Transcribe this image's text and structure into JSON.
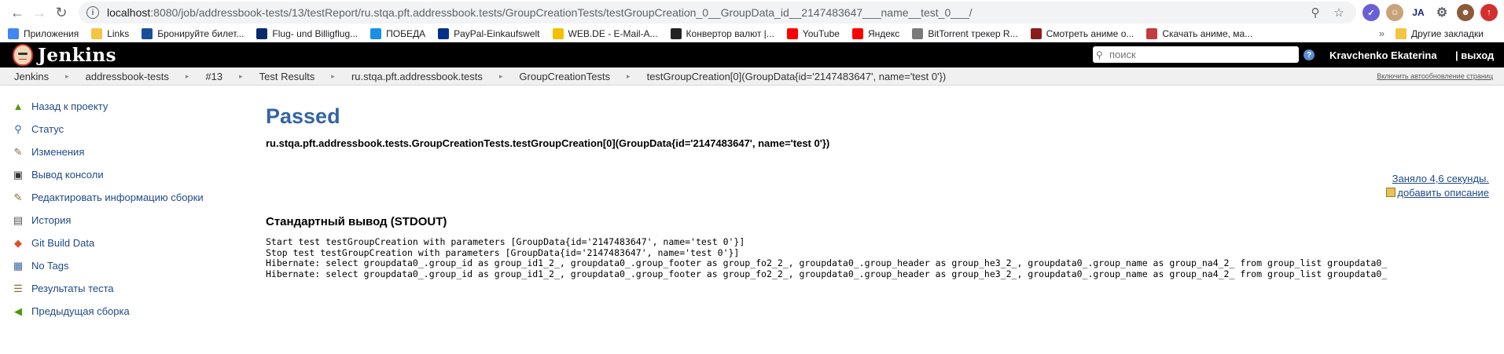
{
  "browser": {
    "url_host": "localhost",
    "url_path": ":8080/job/addressbook-tests/13/testReport/ru.stqa.pft.addressbook.tests/GroupCreationTests/testGroupCreation_0__GroupData_id__2147483647___name__test_0___/"
  },
  "bookmarks": [
    {
      "label": "Приложения",
      "icon": "apps-icon",
      "color": "#4285f4"
    },
    {
      "label": "Links",
      "icon": "folder-icon",
      "color": "#f4c542"
    },
    {
      "label": "Бронируйте билет...",
      "icon": "airline-icon",
      "color": "#1a4e9a"
    },
    {
      "label": "Flug- und Billigflug...",
      "icon": "info-icon",
      "color": "#0b2a6b"
    },
    {
      "label": "ПОБЕДА",
      "icon": "pobeda-icon",
      "color": "#1a8fe3"
    },
    {
      "label": "PayPal-Einkaufswelt",
      "icon": "paypal-icon",
      "color": "#003087"
    },
    {
      "label": "WEB.DE - E-Mail-A...",
      "icon": "webde-icon",
      "color": "#f3c100"
    },
    {
      "label": "Конвертор валют |...",
      "icon": "converter-icon",
      "color": "#222"
    },
    {
      "label": "YouTube",
      "icon": "youtube-icon",
      "color": "#ff0000"
    },
    {
      "label": "Яндекс",
      "icon": "yandex-icon",
      "color": "#ff0000"
    },
    {
      "label": "BitTorrent трекер R...",
      "icon": "torrent-icon",
      "color": "#7a7a7a"
    },
    {
      "label": "Смотреть аниме о...",
      "icon": "anime-icon",
      "color": "#8b1c1c"
    },
    {
      "label": "Скачать аниме, ма...",
      "icon": "anime2-icon",
      "color": "#c43c3c"
    }
  ],
  "bookmarks_other": "Другие закладки",
  "jenkins": {
    "title": "Jenkins",
    "search_placeholder": "поиск",
    "user": "Kravchenko Ekaterina",
    "logout": "| выход"
  },
  "breadcrumbs": [
    "Jenkins",
    "addressbook-tests",
    "#13",
    "Test Results",
    "ru.stqa.pft.addressbook.tests",
    "GroupCreationTests",
    "testGroupCreation[0](GroupData{id='2147483647', name='test 0'})"
  ],
  "auto_refresh": "Включить автообновление страниц",
  "sidebar": [
    {
      "label": "Назад к проекту",
      "icon": "up-arrow-icon"
    },
    {
      "label": "Статус",
      "icon": "search-icon"
    },
    {
      "label": "Изменения",
      "icon": "notepad-icon"
    },
    {
      "label": "Вывод консоли",
      "icon": "terminal-icon"
    },
    {
      "label": "Редактировать информацию сборки",
      "icon": "notepad-icon"
    },
    {
      "label": "История",
      "icon": "history-icon"
    },
    {
      "label": "Git Build Data",
      "icon": "git-icon"
    },
    {
      "label": "No Tags",
      "icon": "save-icon"
    },
    {
      "label": "Результаты теста",
      "icon": "clipboard-icon"
    },
    {
      "label": "Предыдущая сборка",
      "icon": "left-arrow-icon"
    }
  ],
  "content": {
    "status": "Passed",
    "test_name": "ru.stqa.pft.addressbook.tests.GroupCreationTests.testGroupCreation[0](GroupData{id='2147483647', name='test 0'})",
    "duration": "Заняло 4,6 секунды.",
    "add_description": "добавить описание",
    "stdout_heading": "Стандартный вывод (STDOUT)",
    "stdout_lines": [
      "Start test testGroupCreation with parameters [GroupData{id='2147483647', name='test 0'}]",
      "Stop test testGroupCreation with parameters [GroupData{id='2147483647', name='test 0'}]",
      "Hibernate: select groupdata0_.group_id as group_id1_2_, groupdata0_.group_footer as group_fo2_2_, groupdata0_.group_header as group_he3_2_, groupdata0_.group_name as group_na4_2_ from group_list groupdata0_",
      "Hibernate: select groupdata0_.group_id as group_id1_2_, groupdata0_.group_footer as group_fo2_2_, groupdata0_.group_header as group_he3_2_, groupdata0_.group_name as group_na4_2_ from group_list groupdata0_"
    ]
  }
}
